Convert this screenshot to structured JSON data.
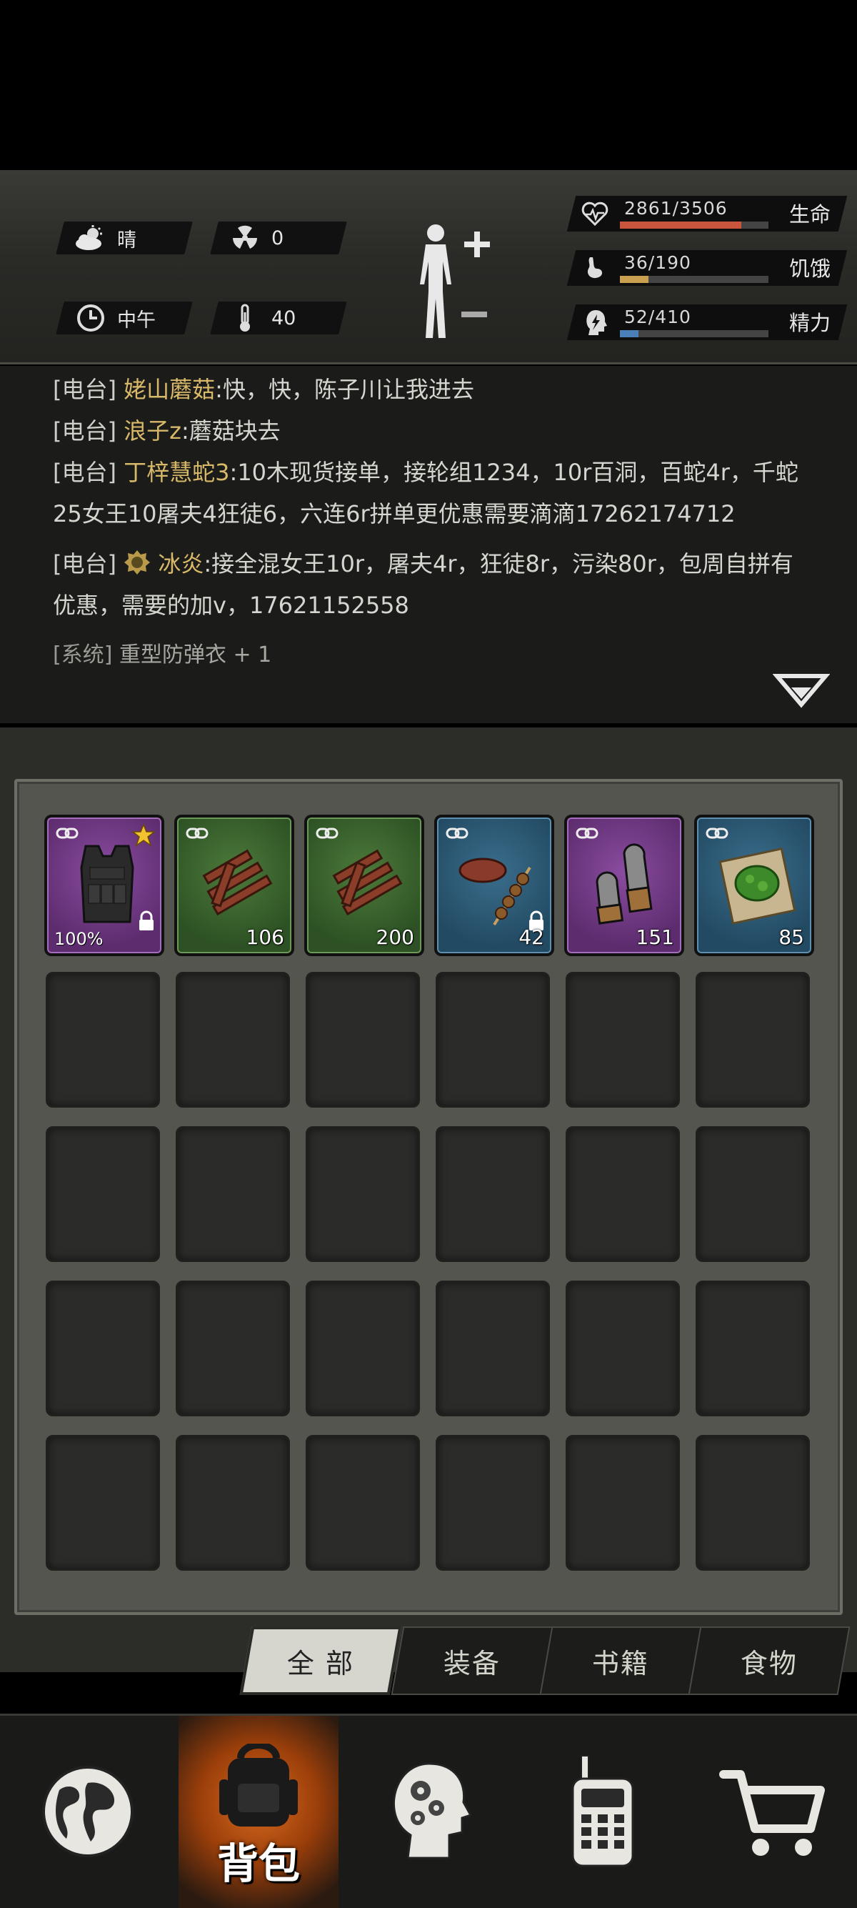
{
  "environment": {
    "weather": {
      "icon": "cloud-sun-icon",
      "label": "晴"
    },
    "radiation": {
      "icon": "radiation-icon",
      "value": "0"
    },
    "time": {
      "icon": "clock-icon",
      "label": "中午"
    },
    "temperature": {
      "icon": "thermometer-icon",
      "value": "40"
    }
  },
  "stats": [
    {
      "icon": "heart-rate-icon",
      "value": "2861/3506",
      "label": "生命",
      "fraction": 0.816,
      "color": "#c9553c"
    },
    {
      "icon": "stomach-icon",
      "value": "36/190",
      "label": "饥饿",
      "fraction": 0.19,
      "color": "#c8a050"
    },
    {
      "icon": "head-energy-icon",
      "value": "52/410",
      "label": "精力",
      "fraction": 0.127,
      "color": "#4a7fb8"
    }
  ],
  "log": {
    "radio_tag": "[电台]",
    "system_tag": "[系统]",
    "messages": [
      {
        "sender": "姥山蘑菇",
        "text": ":快，快，陈子川让我进去"
      },
      {
        "sender": "浪子z",
        "text": ":蘑菇块去"
      },
      {
        "sender": "丁梓慧蛇3",
        "text": ":10木现货接单，接轮组1234，10r百洞，百蛇4r，千蛇25女王10屠夫4狂徒6，六连6r拼单更优惠需要滴滴17262174712"
      },
      {
        "sender": "冰炎",
        "text": ":接全混女王10r，屠夫4r，狂徒8r，污染80r，包周自拼有优惠，需要的加v，17621152558"
      }
    ],
    "system_message": "重型防弹衣 + 1"
  },
  "inventory": {
    "items": [
      {
        "name": "heavy-vest",
        "rarity": "purple",
        "durability": "100%",
        "durability_fraction": 1.0,
        "starred": true,
        "locked": true
      },
      {
        "name": "wood",
        "rarity": "green",
        "count": "106"
      },
      {
        "name": "wood",
        "rarity": "green",
        "count": "200"
      },
      {
        "name": "meat-skewer",
        "rarity": "blue",
        "count": "42",
        "locked": true
      },
      {
        "name": "ammo",
        "rarity": "purple",
        "count": "151"
      },
      {
        "name": "herb-bandage",
        "rarity": "blue",
        "count": "85"
      }
    ]
  },
  "tabs": [
    {
      "label": "全 部",
      "active": true
    },
    {
      "label": "装备",
      "active": false
    },
    {
      "label": "书籍",
      "active": false
    },
    {
      "label": "食物",
      "active": false
    }
  ],
  "nav": [
    {
      "icon": "globe-icon"
    },
    {
      "icon": "backpack-icon",
      "label": "背包"
    },
    {
      "icon": "head-gears-icon"
    },
    {
      "icon": "walkie-talkie-icon"
    },
    {
      "icon": "shopping-cart-icon"
    }
  ]
}
